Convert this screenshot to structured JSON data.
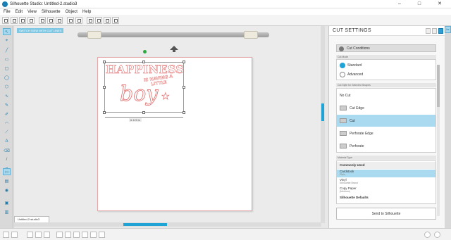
{
  "window": {
    "title": "Silhouette Studio: Untitled-2.studio3"
  },
  "menu": [
    "File",
    "Edit",
    "View",
    "Silhouette",
    "Object",
    "Help"
  ],
  "canvas": {
    "hint": "SWITCH VIEW WITH CUT LINES",
    "art_line1": "HAPPINESS",
    "art_line2": "IS HAVING A LITTLE",
    "art_line3": "boy",
    "dimension": "6.123 in"
  },
  "document_tab": "Untitled-2.studio3",
  "panel": {
    "title": "CUT SETTINGS",
    "section": "Cut Conditions",
    "cut_mode_label": "Cut Mode",
    "modes": [
      "Standard",
      "Advanced"
    ],
    "cut_style_label": "Cut Style for Selected Shapes",
    "cut_styles": [
      "No Cut",
      "Cut Edge",
      "Cut",
      "Perforate Edge",
      "Perforate"
    ],
    "material_type_label": "Material Type",
    "materials_header": "Commonly Used",
    "materials": [
      {
        "name": "Cardstock",
        "sub": "Plain"
      },
      {
        "name": "Vinyl",
        "sub": "Silhouette Brand"
      },
      {
        "name": "Copy Paper",
        "sub": "(Medium)"
      },
      {
        "name": "Silhouette Defaults",
        "sub": ""
      }
    ],
    "send_button": "Send to Silhouette"
  },
  "colors": {
    "accent": "#1fa4d6",
    "art_stroke": "#e06a6a",
    "selection": "#a9daf0",
    "rotate_handle": "#2aaa3c"
  }
}
